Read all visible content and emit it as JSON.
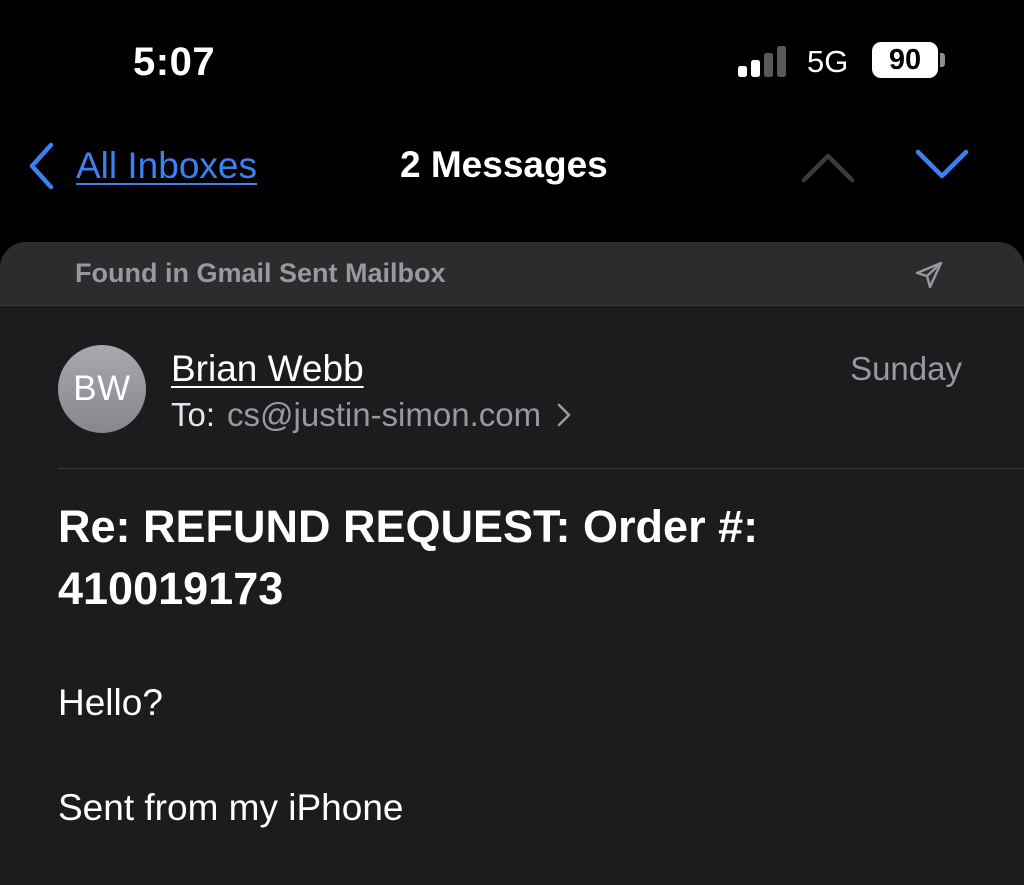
{
  "status_bar": {
    "time": "5:07",
    "network": "5G",
    "battery": "90"
  },
  "nav": {
    "back_label": "All Inboxes",
    "title": "2 Messages"
  },
  "banner": {
    "text": "Found in Gmail Sent Mailbox"
  },
  "message": {
    "avatar_initials": "BW",
    "sender_name": "Brian Webb",
    "to_label": "To:",
    "to_address": "cs@justin-simon.com",
    "date": "Sunday",
    "subject": "Re: REFUND REQUEST: Order #: 410019173",
    "body": [
      "Hello?",
      "Sent from my iPhone"
    ]
  },
  "colors": {
    "accent": "#3b82f0",
    "background": "#000000",
    "card": "#1c1c1e",
    "secondary_text": "#98989f"
  }
}
